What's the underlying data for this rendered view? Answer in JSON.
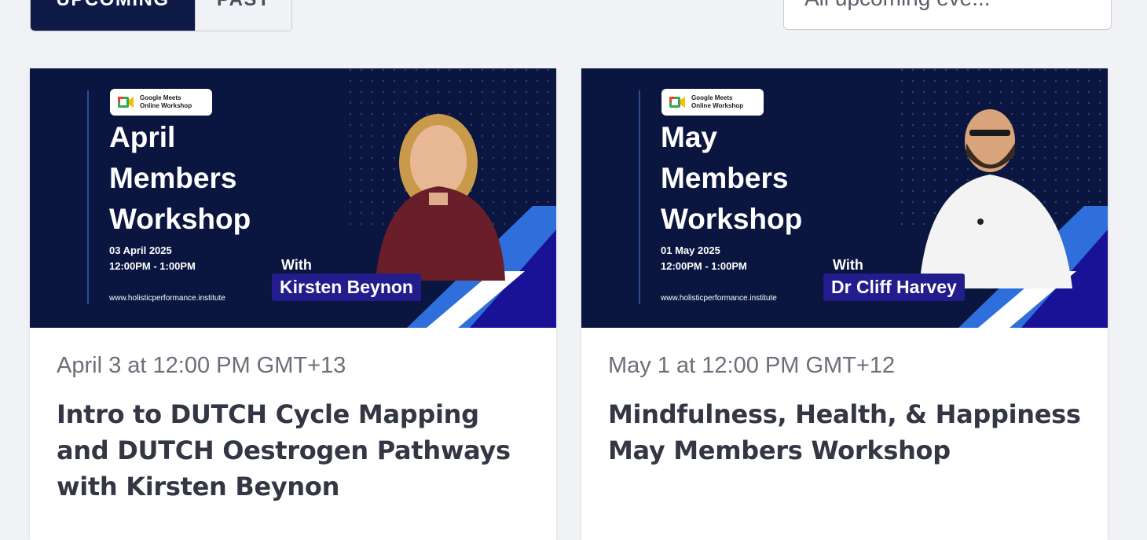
{
  "tabs": {
    "upcoming": "UPCOMING",
    "past": "PAST"
  },
  "filter": {
    "value": "All upcoming eve..."
  },
  "events": [
    {
      "badge": {
        "line1": "Google Meets",
        "line2": "Online Workshop"
      },
      "headline": [
        "April",
        "Members",
        "Workshop"
      ],
      "banner_date": "03 April 2025",
      "banner_time": "12:00PM - 1:00PM",
      "website": "www.holisticperformance.institute",
      "with": "With",
      "speaker": "Kirsten Beynon",
      "date": "April 3 at 12:00 PM GMT+13",
      "title": "Intro to DUTCH Cycle Mapping and DUTCH Oestrogen Pathways with Kirsten Beynon"
    },
    {
      "badge": {
        "line1": "Google Meets",
        "line2": "Online Workshop"
      },
      "headline": [
        "May",
        "Members",
        "Workshop"
      ],
      "banner_date": "01 May 2025",
      "banner_time": "12:00PM - 1:00PM",
      "website": "www.holisticperformance.institute",
      "with": "With",
      "speaker": "Dr Cliff Harvey",
      "date": "May 1 at 12:00 PM GMT+12",
      "title": "Mindfulness, Health, & Happiness May Members Workshop"
    }
  ],
  "colors": {
    "navy": "#0a1640",
    "accent_blue": "#2e6fdc",
    "tab_active": "#0d1b46"
  }
}
